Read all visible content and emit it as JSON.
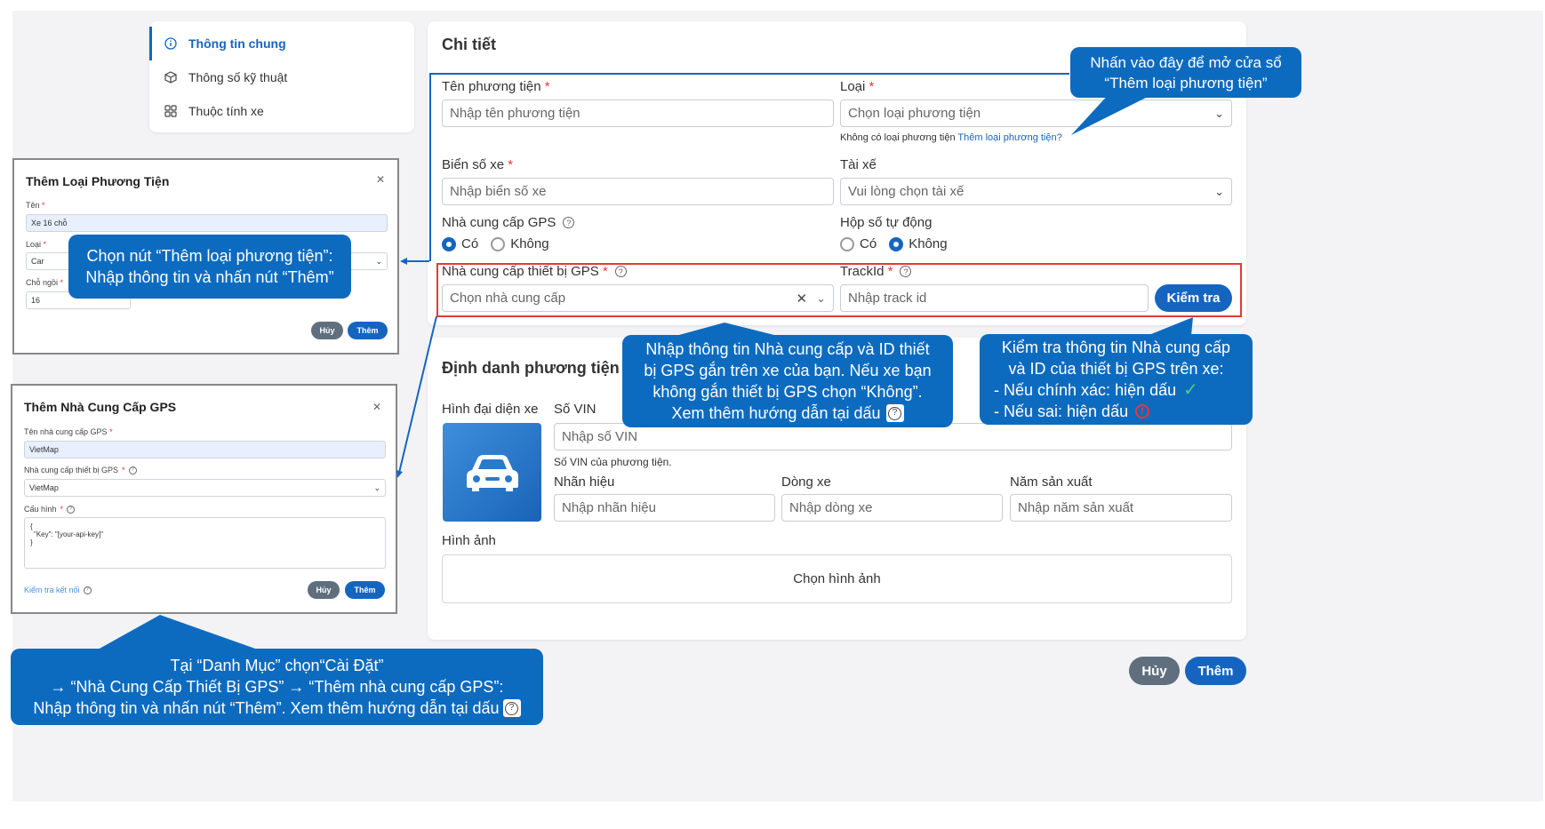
{
  "nav": {
    "items": [
      {
        "icon": "info-circle-icon",
        "label": "Thông tin chung"
      },
      {
        "icon": "cube-icon",
        "label": "Thông số kỹ thuật"
      },
      {
        "icon": "grid-icon",
        "label": "Thuộc tính xe"
      }
    ]
  },
  "detail": {
    "title": "Chi tiết",
    "vehicle_name": {
      "label": "Tên phương tiện",
      "placeholder": "Nhập tên phương tiện"
    },
    "type": {
      "label": "Loại",
      "placeholder": "Chọn loại phương tiện",
      "hint": "Không có loại phương tiện",
      "hint_link": "Thêm loại phương tiện?"
    },
    "plate": {
      "label": "Biển số xe",
      "placeholder": "Nhập biển số xe"
    },
    "driver": {
      "label": "Tài xế",
      "placeholder": "Vui lòng chọn tài xế"
    },
    "gps_provider": {
      "label": "Nhà cung cấp GPS",
      "opt_yes": "Có",
      "opt_no": "Không"
    },
    "auto_gear": {
      "label": "Hộp số tự động",
      "opt_yes": "Có",
      "opt_no": "Không"
    },
    "gps_device": {
      "label": "Nhà cung cấp thiết bị GPS",
      "placeholder": "Chọn nhà cung cấp"
    },
    "trackid": {
      "label": "TrackId",
      "placeholder": "Nhập track id",
      "check_button": "Kiểm tra"
    }
  },
  "identity": {
    "title": "Định danh phương tiện",
    "avatar_label": "Hình đại diện xe",
    "vin": {
      "label": "Số VIN",
      "placeholder": "Nhập số VIN",
      "hint": "Số VIN của phương tiện."
    },
    "brand": {
      "label": "Nhãn hiệu",
      "placeholder": "Nhập nhãn hiệu"
    },
    "model": {
      "label": "Dòng xe",
      "placeholder": "Nhập dòng xe"
    },
    "year": {
      "label": "Năm sản xuất",
      "placeholder": "Nhập năm sản xuất"
    },
    "images_label": "Hình ảnh",
    "images_button": "Chọn hình ảnh"
  },
  "footer": {
    "cancel": "Hủy",
    "add": "Thêm"
  },
  "modal_type": {
    "title": "Thêm Loại Phương Tiện",
    "name_label": "Tên",
    "name_value": "Xe 16 chỗ",
    "type_label": "Loại",
    "type_value": "Car",
    "seats_label": "Chỗ ngồi",
    "seats_value": "16",
    "cancel": "Hủy",
    "add": "Thêm"
  },
  "modal_gps": {
    "title": "Thêm Nhà Cung Cấp GPS",
    "name_label": "Tên nhà cung cấp GPS",
    "name_value": "VietMap",
    "device_label": "Nhà cung cấp thiết bị GPS",
    "device_value": "VietMap",
    "config_label": "Cấu hình",
    "config_line1": "{",
    "config_line2": "\"Key\": \"[your-api-key]\"",
    "config_line3": "}",
    "test_link": "Kiểm tra kết nối",
    "cancel": "Hủy",
    "add": "Thêm"
  },
  "callouts": {
    "top_right": [
      "Nhấn vào đây để mở cửa sổ",
      "“Thêm loại phương tiện”"
    ],
    "type_modal": [
      "Chọn nút “Thêm loại phương tiện”:",
      "Nhập thông tin và nhấn nút “Thêm”"
    ],
    "gps_info": [
      "Nhập thông tin Nhà cung cấp và ID thiết",
      "bị GPS gắn trên xe của bạn. Nếu xe bạn",
      "không gắn thiết bị GPS chọn “Không”.",
      "Xem thêm hướng dẫn tại dấu"
    ],
    "check": [
      "Kiểm tra thông tin Nhà cung cấp",
      "và ID của thiết bị GPS trên xe:",
      "- Nếu chính xác: hiện dấu",
      "- Nếu sai: hiện dấu"
    ],
    "bottom": [
      "Tại “Danh Mục” chọn“Cài Đặt”",
      "→ “Nhà Cung Cấp Thiết Bị GPS” → “Thêm nhà cung cấp GPS”:",
      "Nhập thông tin và nhấn nút “Thêm”. Xem thêm hướng dẫn tại dấu"
    ]
  },
  "colors": {
    "accent": "#1565c0",
    "callout": "#0d6bbf",
    "highlight": "#e53935"
  }
}
